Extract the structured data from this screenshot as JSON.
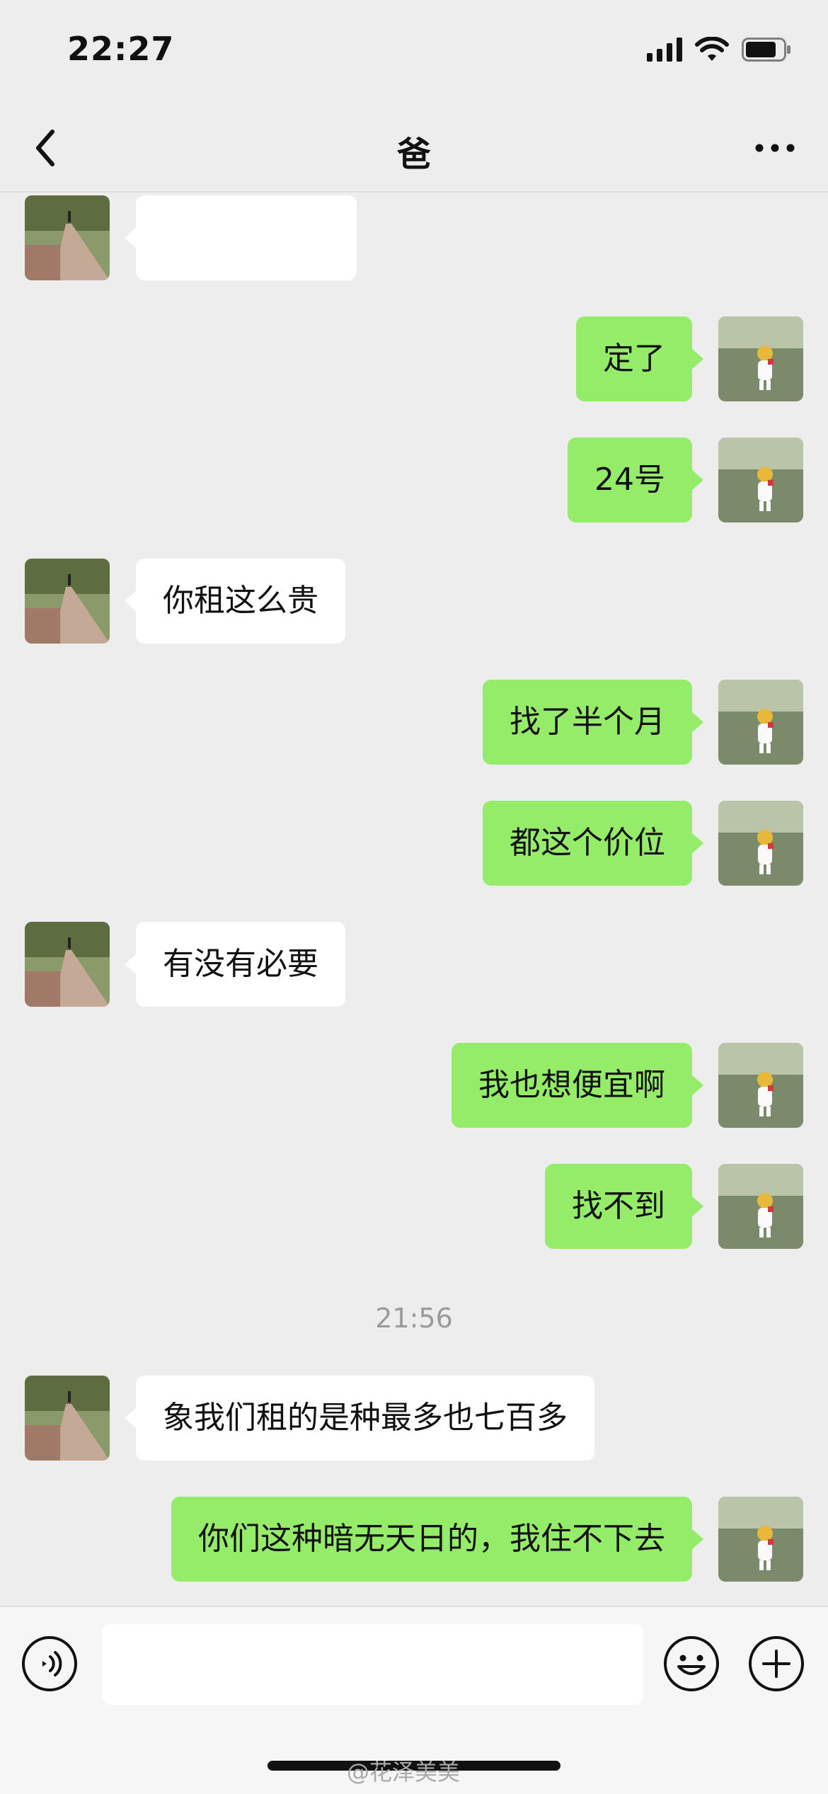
{
  "status": {
    "time": "22:27"
  },
  "header": {
    "title": "爸"
  },
  "messages": [
    {
      "from": "dad",
      "text": ""
    },
    {
      "from": "me",
      "text": "定了"
    },
    {
      "from": "me",
      "text": "24号"
    },
    {
      "from": "dad",
      "text": "你租这么贵"
    },
    {
      "from": "me",
      "text": "找了半个月"
    },
    {
      "from": "me",
      "text": "都这个价位"
    },
    {
      "from": "dad",
      "text": "有没有必要"
    },
    {
      "from": "me",
      "text": "我也想便宜啊"
    },
    {
      "from": "me",
      "text": "找不到"
    },
    {
      "from": "dad",
      "text": "象我们租的是种最多也七百多"
    },
    {
      "from": "me",
      "text": "你们这种暗无天日的，我住不下去"
    }
  ],
  "timestamp": "21:56",
  "input": {
    "value": "",
    "placeholder": ""
  },
  "watermark": "@花泽美美",
  "colors": {
    "background": "#ededed",
    "outgoing_bubble": "#95ec69",
    "incoming_bubble": "#ffffff"
  },
  "icons": [
    "back-chevron-icon",
    "more-dots-icon",
    "voice-icon",
    "emoji-icon",
    "plus-icon"
  ]
}
